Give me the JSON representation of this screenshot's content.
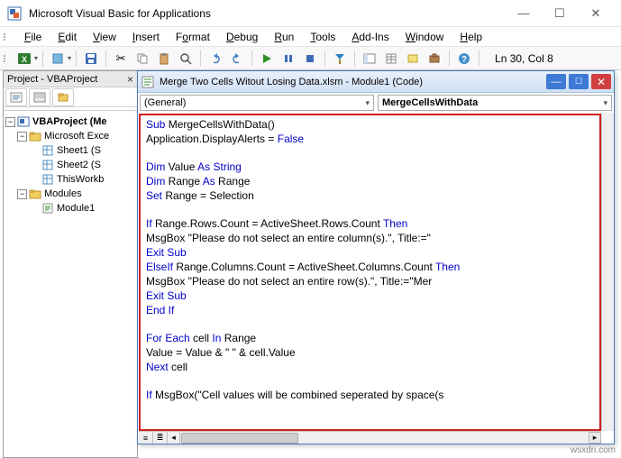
{
  "window": {
    "title": "Microsoft Visual Basic for Applications"
  },
  "menu": {
    "file": "File",
    "edit": "Edit",
    "view": "View",
    "insert": "Insert",
    "format": "Format",
    "debug": "Debug",
    "run": "Run",
    "tools": "Tools",
    "addins": "Add-Ins",
    "window": "Window",
    "help": "Help"
  },
  "toolbar": {
    "status": "Ln 30, Col 8"
  },
  "project": {
    "title": "Project - VBAProject",
    "root": "VBAProject (Me",
    "folder_excel": "Microsoft Exce",
    "sheet1": "Sheet1 (S",
    "sheet2": "Sheet2 (S",
    "thiswb": "ThisWorkb",
    "folder_modules": "Modules",
    "module1": "Module1"
  },
  "code_window": {
    "title": "Merge Two Cells Witout Losing Data.xlsm - Module1 (Code)",
    "dd_left": "(General)",
    "dd_right": "MergeCellsWithData",
    "lines": {
      "l1a": "Sub",
      "l1b": " MergeCellsWithData()",
      "l2a": "Application.DisplayAlerts = ",
      "l2b": "False",
      "l4a": "Dim",
      "l4b": " Value ",
      "l4c": "As String",
      "l5a": "Dim",
      "l5b": " Range ",
      "l5c": "As",
      "l5d": " Range",
      "l6a": "Set",
      "l6b": " Range = Selection",
      "l8a": "If",
      "l8b": " Range.Rows.Count = ActiveSheet.Rows.Count ",
      "l8c": "Then",
      "l9": "MsgBox \"Please do not select an entire column(s).\", Title:=\"",
      "l10": "Exit Sub",
      "l11a": "ElseIf",
      "l11b": " Range.Columns.Count = ActiveSheet.Columns.Count ",
      "l11c": "Then",
      "l12": "MsgBox \"Please do not select an entire row(s).\", Title:=\"Mer",
      "l13": "Exit Sub",
      "l14": "End If",
      "l16a": "For Each",
      "l16b": " cell ",
      "l16c": "In",
      "l16d": " Range",
      "l17": "Value = Value & \" \" & cell.Value",
      "l18a": "Next",
      "l18b": " cell",
      "l20a": "If",
      "l20b": " MsgBox(\"Cell values will be combined seperated by space(s"
    }
  },
  "watermark": "wsxdn.com"
}
